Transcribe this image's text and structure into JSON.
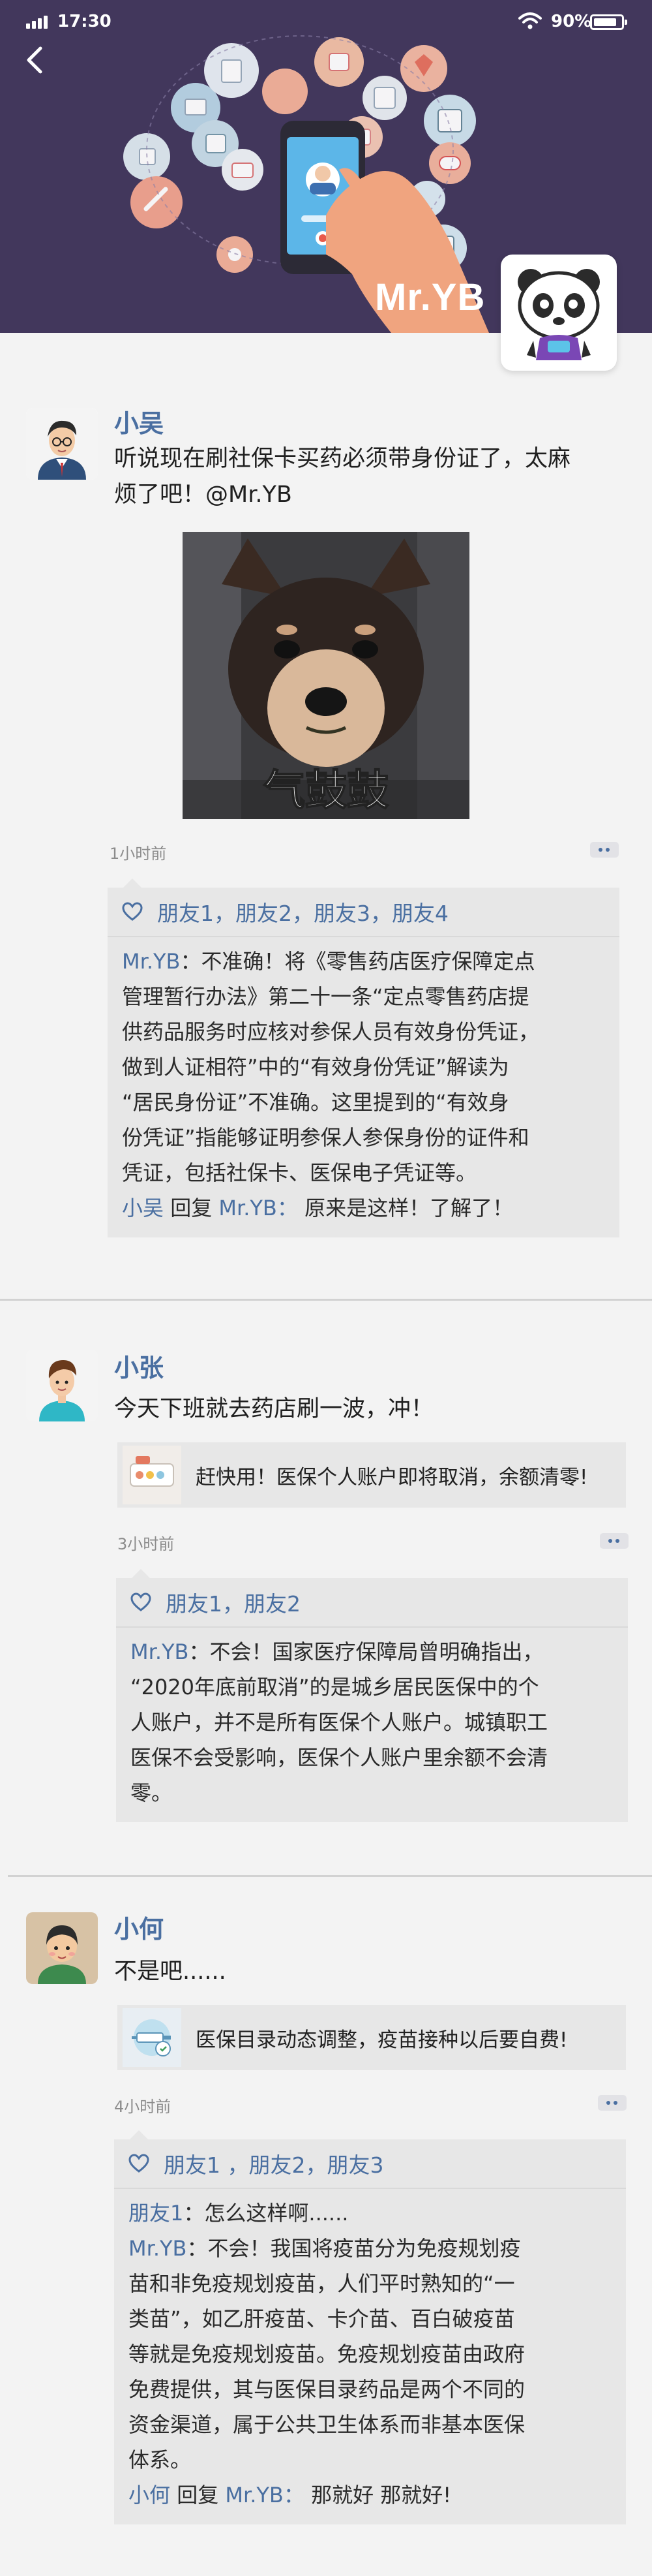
{
  "status_bar": {
    "time": "17:30",
    "battery": "90%"
  },
  "banner": {
    "brand": "Mr.YB"
  },
  "icons": {
    "back": "back-arrow-icon",
    "like": "heart-icon",
    "more": "more-dots-icon",
    "logo": "panda-mascot-icon"
  },
  "colors": {
    "banner_bg": "#42375c",
    "nickname": "#4a6fa1",
    "comment_bg": "#e7e7e7",
    "page_bg": "#f3f3f3"
  },
  "posts": [
    {
      "author": "小吴",
      "lines": [
        "听说现在刷社保卡买药必须带身份证了，太麻",
        "烦了吧！@Mr.YB"
      ],
      "image_caption": "气鼓鼓",
      "time": "1小时前",
      "likes": "朋友1，朋友2，朋友3，朋友4",
      "comments": [
        {
          "from": "Mr.YB",
          "sep": "：",
          "lines": [
            "不准确！将《零售药店医疗保障定点",
            "管理暂行办法》第二十一条“定点零售药店提",
            "供药品服务时应核对参保人员有效身份凭证，",
            "做到人证相符”中的“有效身份凭证”解读为",
            "“居民身份证”不准确。这里提到的“有效身",
            "份凭证”指能够证明参保人参保身份的证件和",
            "凭证，包括社保卡、医保电子凭证等。"
          ]
        },
        {
          "from": "小吴",
          "reply_word": " 回复 ",
          "to": "Mr.YB",
          "sep": "：",
          "text": " 原来是这样！了解了！"
        }
      ]
    },
    {
      "author": "小张",
      "lines": [
        "今天下班就去药店刷一波，冲！"
      ],
      "link_title": "赶快用！医保个人账户即将取消，余额清零!",
      "time": "3小时前",
      "likes": "朋友1，朋友2",
      "comments": [
        {
          "from": "Mr.YB",
          "sep": "：",
          "lines": [
            "不会！国家医疗保障局曾明确指出，",
            "“2020年底前取消”的是城乡居民医保中的个",
            "人账户，并不是所有医保个人账户。城镇职工",
            "医保不会受影响，医保个人账户里余额不会清",
            "零。"
          ]
        }
      ]
    },
    {
      "author": "小何",
      "lines": [
        "不是吧......"
      ],
      "link_title": "医保目录动态调整，疫苗接种以后要自费!",
      "time": "4小时前",
      "likes": "朋友1 ，朋友2，朋友3",
      "comments": [
        {
          "from": "朋友1",
          "sep": "：",
          "lines": [
            "怎么这样啊......"
          ]
        },
        {
          "from": "Mr.YB",
          "sep": "：",
          "lines": [
            "不会！我国将疫苗分为免疫规划疫",
            "苗和非免疫规划疫苗，人们平时熟知的“一",
            "类苗”，如乙肝疫苗、卡介苗、百白破疫苗",
            "等就是免疫规划疫苗。免疫规划疫苗由政府",
            "免费提供，其与医保目录药品是两个不同的",
            "资金渠道，属于公共卫生体系而非基本医保",
            "体系。"
          ]
        },
        {
          "from": "小何",
          "reply_word": " 回复 ",
          "to": "Mr.YB",
          "sep": "：",
          "text": " 那就好 那就好!"
        }
      ]
    }
  ]
}
